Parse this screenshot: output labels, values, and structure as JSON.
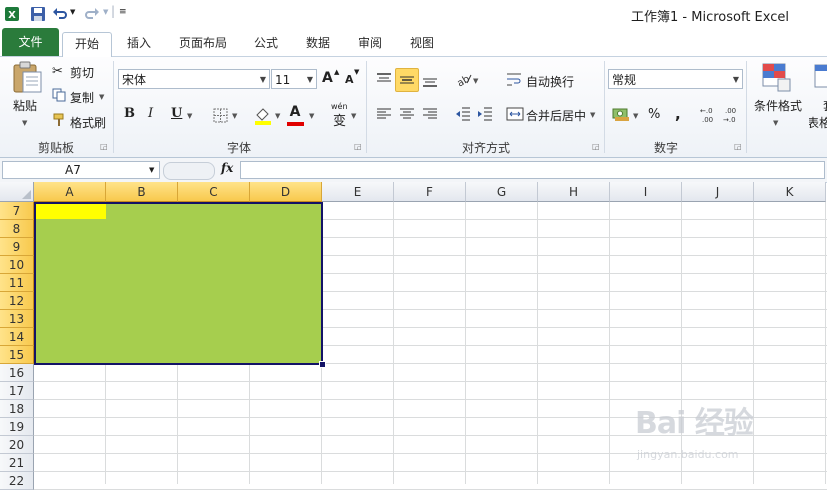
{
  "window": {
    "title": "工作簿1 - Microsoft Excel"
  },
  "quick_access": [
    "excel-icon",
    "save-icon",
    "undo-icon",
    "redo-icon",
    "customize-icon"
  ],
  "tabs": [
    {
      "id": "file",
      "label": "文件"
    },
    {
      "id": "home",
      "label": "开始"
    },
    {
      "id": "insert",
      "label": "插入"
    },
    {
      "id": "layout",
      "label": "页面布局"
    },
    {
      "id": "formulas",
      "label": "公式"
    },
    {
      "id": "data",
      "label": "数据"
    },
    {
      "id": "review",
      "label": "审阅"
    },
    {
      "id": "view",
      "label": "视图"
    }
  ],
  "ribbon": {
    "clipboard": {
      "paste": "粘贴",
      "cut": "剪切",
      "copy": "复制",
      "format_painter": "格式刷",
      "group": "剪贴板"
    },
    "font": {
      "name": "宋体",
      "size": "11",
      "bold": "B",
      "italic": "I",
      "underline": "U",
      "grow": "A",
      "shrink": "A",
      "phonetic": "wén",
      "phonetic_char": "变",
      "group": "字体"
    },
    "alignment": {
      "wrap": "自动换行",
      "merge": "合并后居中",
      "group": "对齐方式"
    },
    "number": {
      "format": "常规",
      "percent": "%",
      "comma": ",",
      "group": "数字"
    },
    "styles": {
      "conditional": "条件格式",
      "partial_1": "套",
      "partial_2": "表格"
    }
  },
  "formula_bar": {
    "name_box": "A7",
    "fx": "fx",
    "formula": ""
  },
  "grid": {
    "columns": [
      "A",
      "B",
      "C",
      "D",
      "E",
      "F",
      "G",
      "H",
      "I",
      "J",
      "K"
    ],
    "selected_columns": [
      "A",
      "B",
      "C",
      "D"
    ],
    "rows": [
      "7",
      "8",
      "9",
      "10",
      "11",
      "12",
      "13",
      "14",
      "15",
      "16",
      "17",
      "18",
      "19",
      "20",
      "21",
      "22"
    ],
    "selected_rows": [
      "7",
      "8",
      "9",
      "10",
      "11",
      "12",
      "13",
      "14",
      "15"
    ],
    "active_cell": "A7",
    "selection_range": "A7:D15",
    "selection_fill_color": "#a6ce4e",
    "active_cell_color": "#ffff00"
  },
  "watermark": {
    "logo": "Bai 经验",
    "url": "jingyan.baidu.com"
  }
}
